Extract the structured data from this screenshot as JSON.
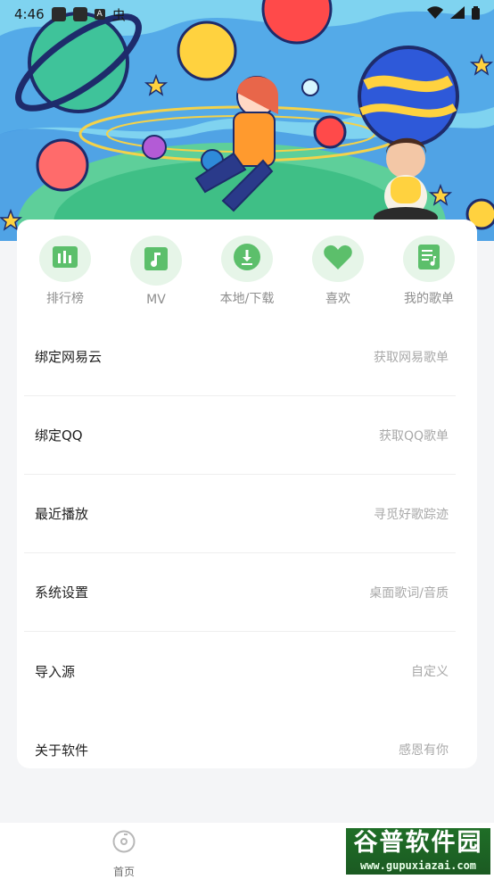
{
  "status_bar": {
    "time": "4:46",
    "badge_a": "A",
    "badge_bug": "虫"
  },
  "quick_actions": [
    {
      "label": "排行榜",
      "icon": "chart-bars-icon"
    },
    {
      "label": "MV",
      "icon": "music-note-icon"
    },
    {
      "label": "本地/下载",
      "icon": "download-icon"
    },
    {
      "label": "喜欢",
      "icon": "heart-icon"
    },
    {
      "label": "我的歌单",
      "icon": "playlist-icon"
    }
  ],
  "menu": [
    {
      "title": "绑定网易云",
      "subtitle": "获取网易歌单"
    },
    {
      "title": "绑定QQ",
      "subtitle": "获取QQ歌单"
    },
    {
      "title": "最近播放",
      "subtitle": "寻觅好歌踪迹"
    },
    {
      "title": "系统设置",
      "subtitle": "桌面歌词/音质"
    },
    {
      "title": "导入源",
      "subtitle": "自定义"
    },
    {
      "title": "关于软件",
      "subtitle": "感恩有你"
    }
  ],
  "bottom_nav": {
    "home_label": "首页"
  },
  "watermark": {
    "title": "谷普软件园",
    "url": "www.gupuxiazai.com"
  },
  "colors": {
    "accent": "#5cbf6b",
    "accent_light": "#e6f5e8",
    "page_bg": "#f4f5f7",
    "banner_bg": "#7fd3f0"
  }
}
